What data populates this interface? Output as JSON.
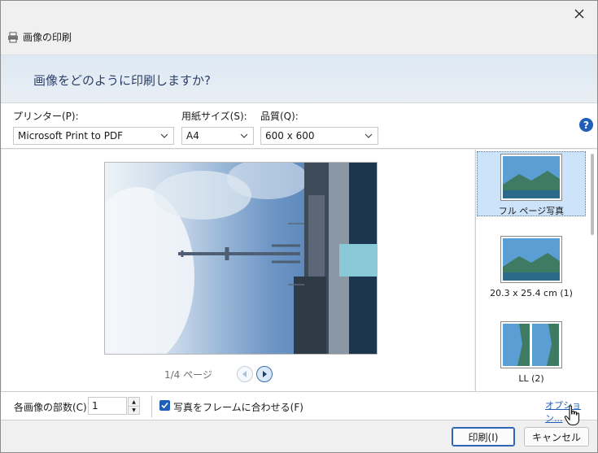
{
  "window": {
    "title": "画像の印刷",
    "heading": "画像をどのように印刷しますか?"
  },
  "settings": {
    "printer": {
      "label": "プリンター(P):",
      "value": "Microsoft Print to PDF"
    },
    "paper_size": {
      "label": "用紙サイズ(S):",
      "value": "A4"
    },
    "quality": {
      "label": "品質(Q):",
      "value": "600 x 600"
    }
  },
  "preview": {
    "page_label": "1/4 ページ"
  },
  "layouts": [
    {
      "label": "フル ページ写真",
      "selected": true
    },
    {
      "label": "20.3 x 25.4 cm (1)",
      "selected": false
    },
    {
      "label": "LL (2)",
      "selected": false
    }
  ],
  "bottom": {
    "copies_label": "各画像の部数(C):",
    "copies_value": "1",
    "fit_label": "写真をフレームに合わせる(F)",
    "fit_checked": true,
    "options_link": "オプション..."
  },
  "buttons": {
    "print": "印刷(I)",
    "cancel": "キャンセル"
  },
  "colors": {
    "accent": "#1f5fb8",
    "header_text": "#2b3f6b"
  }
}
